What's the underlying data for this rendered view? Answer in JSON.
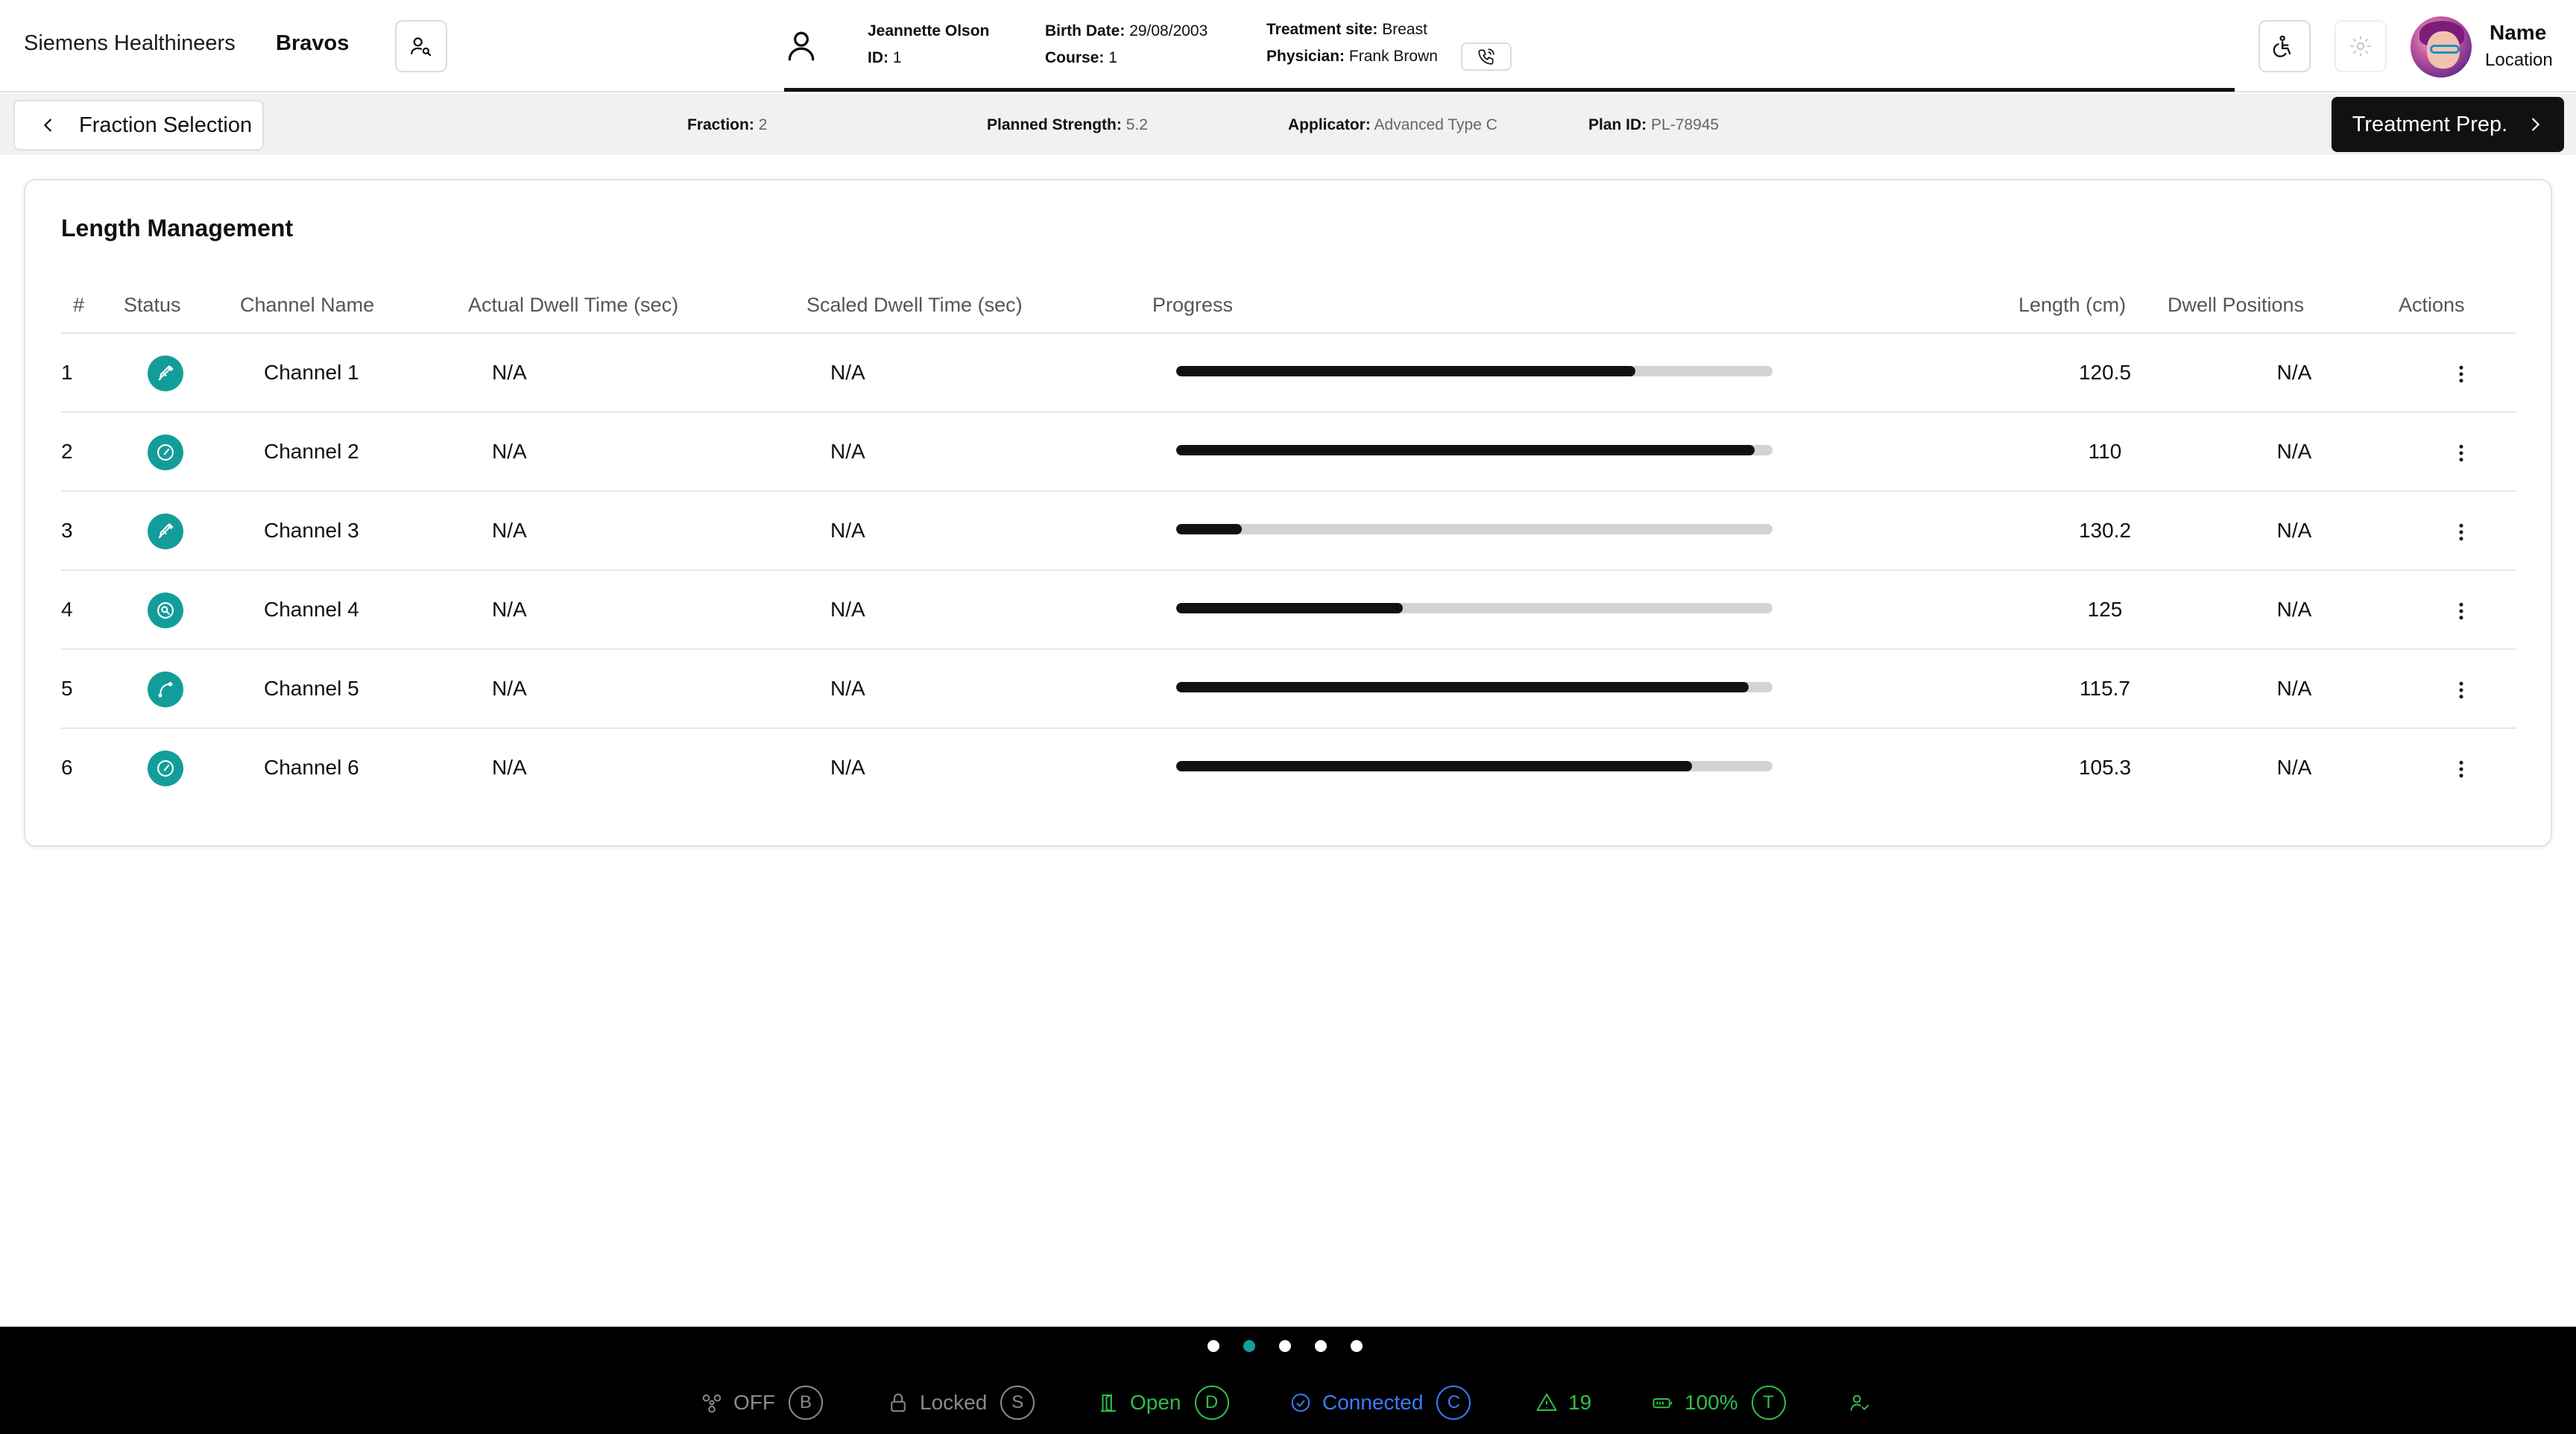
{
  "header": {
    "brand": "Siemens Healthineers",
    "product": "Bravos",
    "patient": {
      "name": "Jeannette Olson",
      "id_label": "ID:",
      "id": "1",
      "birth_label": "Birth Date:",
      "birth": "29/08/2003",
      "course_label": "Course:",
      "course": "1",
      "site_label": "Treatment site:",
      "site": "Breast",
      "physician_label": "Physician:",
      "physician": "Frank Brown"
    },
    "user": {
      "name": "Name",
      "location": "Location"
    }
  },
  "subbar": {
    "back_label": "Fraction Selection",
    "fraction_label": "Fraction:",
    "fraction": "2",
    "strength_label": "Planned Strength:",
    "strength": "5.2",
    "applicator_label": "Applicator:",
    "applicator": "Advanced Type C",
    "plan_label": "Plan ID:",
    "plan": "PL-78945",
    "next_label": "Treatment Prep."
  },
  "table": {
    "title": "Length Management",
    "columns": [
      "#",
      "Status",
      "Channel Name",
      "Actual Dwell Time (sec)",
      "Scaled Dwell Time (sec)",
      "Progress",
      "Length (cm)",
      "Dwell Positions",
      "Actions"
    ],
    "rows": [
      {
        "num": "1",
        "status_icon": "syringe-icon",
        "name": "Channel 1",
        "actual": "N/A",
        "scaled": "N/A",
        "progress": 0.77,
        "length": "120.5",
        "dwell": "N/A"
      },
      {
        "num": "2",
        "status_icon": "gauge-icon",
        "name": "Channel 2",
        "actual": "N/A",
        "scaled": "N/A",
        "progress": 0.97,
        "length": "110",
        "dwell": "N/A"
      },
      {
        "num": "3",
        "status_icon": "syringe-icon",
        "name": "Channel 3",
        "actual": "N/A",
        "scaled": "N/A",
        "progress": 0.11,
        "length": "130.2",
        "dwell": "N/A"
      },
      {
        "num": "4",
        "status_icon": "search-icon",
        "name": "Channel 4",
        "actual": "N/A",
        "scaled": "N/A",
        "progress": 0.38,
        "length": "125",
        "dwell": "N/A"
      },
      {
        "num": "5",
        "status_icon": "catheter-icon",
        "name": "Channel 5",
        "actual": "N/A",
        "scaled": "N/A",
        "progress": 0.96,
        "length": "115.7",
        "dwell": "N/A"
      },
      {
        "num": "6",
        "status_icon": "gauge-icon",
        "name": "Channel 6",
        "actual": "N/A",
        "scaled": "N/A",
        "progress": 0.865,
        "length": "105.3",
        "dwell": "N/A"
      }
    ]
  },
  "footer": {
    "pages": 5,
    "active_page": 2,
    "items": [
      {
        "label": "OFF",
        "key": "B",
        "icon": "radiation-icon",
        "color": "#8a8a8a"
      },
      {
        "label": "Locked",
        "key": "S",
        "icon": "lock-icon",
        "color": "#8a8a8a"
      },
      {
        "label": "Open",
        "key": "D",
        "icon": "door-open-icon",
        "color": "#2fbf4a"
      },
      {
        "label": "Connected",
        "key": "C",
        "icon": "check-circle-icon",
        "color": "#3a7bff"
      },
      {
        "label": "19",
        "key": "",
        "icon": "warning-icon",
        "color": "#2fbf4a"
      },
      {
        "label": "100%",
        "key": "T",
        "icon": "battery-icon",
        "color": "#2fbf4a"
      },
      {
        "label": "",
        "key": "",
        "icon": "user-check-icon",
        "color": "#2fbf4a"
      }
    ]
  },
  "colors": {
    "accent": "#139d9a",
    "dark": "#111111"
  }
}
